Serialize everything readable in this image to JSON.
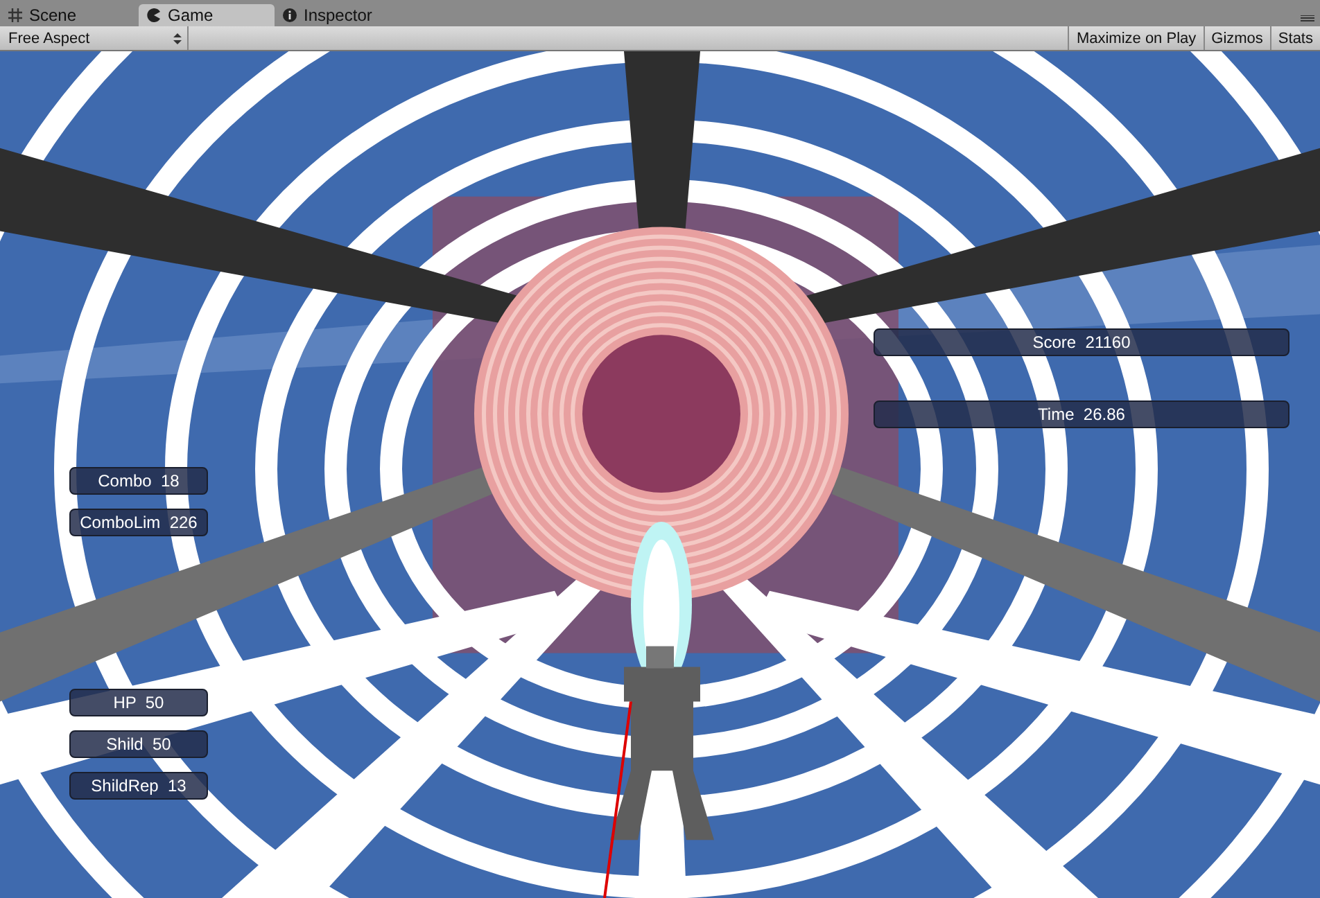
{
  "tabs": [
    {
      "label": "Scene",
      "kind": "scene",
      "selected": false
    },
    {
      "label": "Game",
      "kind": "game",
      "selected": true
    },
    {
      "label": "Inspector",
      "kind": "inspector",
      "selected": false
    }
  ],
  "toolbar": {
    "aspect_dropdown": "Free Aspect",
    "buttons": [
      "Maximize on Play",
      "Gizmos",
      "Stats"
    ]
  },
  "hud": {
    "score_panel": [
      "Score  21160",
      "Time  26.86"
    ],
    "combo_panel": [
      "Combo  18",
      "ComboLim  226"
    ],
    "status_panel": [
      "HP  50",
      "Shild  50",
      "ShildRep  13"
    ]
  }
}
